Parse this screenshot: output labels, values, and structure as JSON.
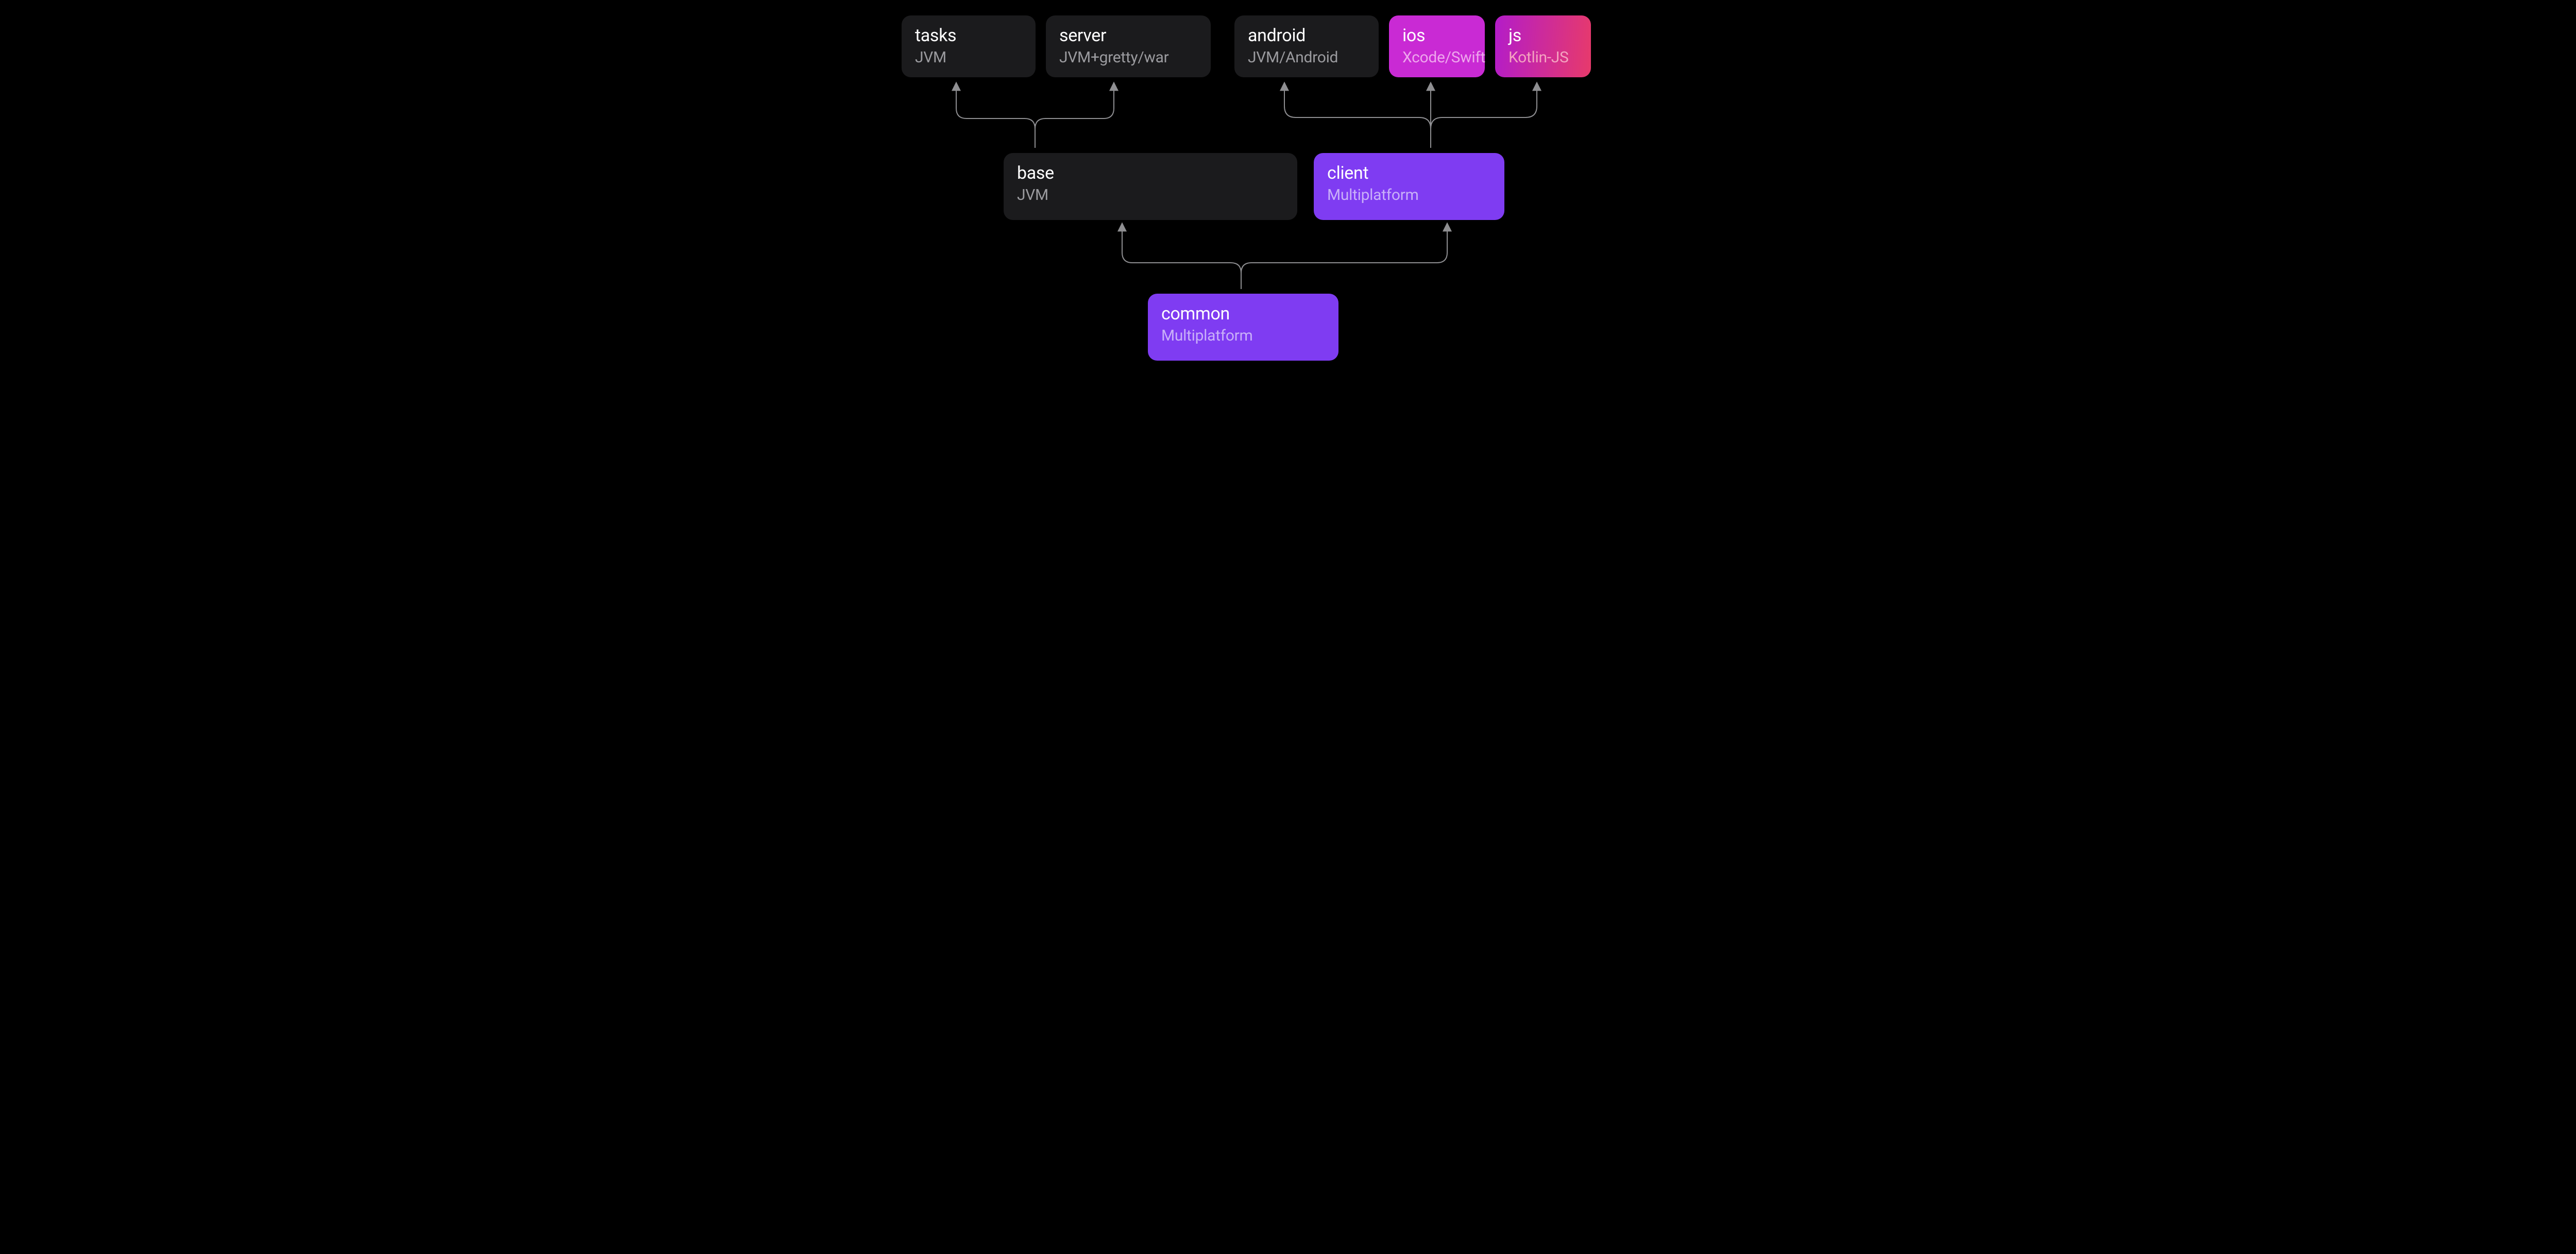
{
  "nodes": {
    "tasks": {
      "title": "tasks",
      "subtitle": "JVM"
    },
    "server": {
      "title": "server",
      "subtitle": "JVM+gretty/war"
    },
    "android": {
      "title": "android",
      "subtitle": "JVM/Android"
    },
    "ios": {
      "title": "ios",
      "subtitle": "Xcode/Swift"
    },
    "js": {
      "title": "js",
      "subtitle": "Kotlin-JS"
    },
    "base": {
      "title": "base",
      "subtitle": "JVM"
    },
    "client": {
      "title": "client",
      "subtitle": "Multiplatform"
    },
    "common": {
      "title": "common",
      "subtitle": "Multiplatform"
    }
  },
  "edges": [
    [
      "common",
      "base"
    ],
    [
      "common",
      "client"
    ],
    [
      "base",
      "tasks"
    ],
    [
      "base",
      "server"
    ],
    [
      "client",
      "android"
    ],
    [
      "client",
      "ios"
    ],
    [
      "client",
      "js"
    ]
  ]
}
